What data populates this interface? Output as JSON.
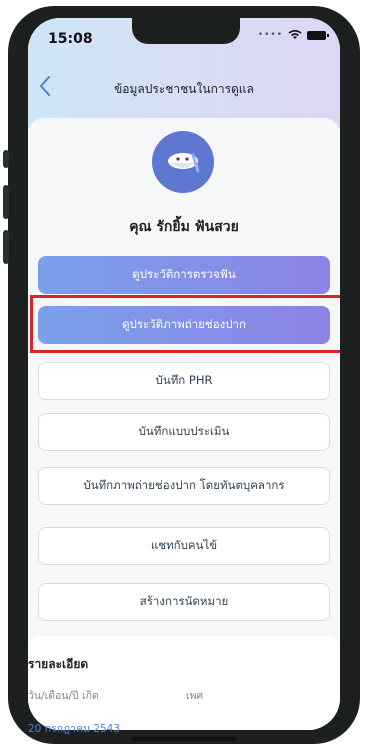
{
  "status_bar": {
    "time": "15:08"
  },
  "header": {
    "title": "ข้อมูลประชาชนในการดูแล",
    "back_icon": "chevron-left-icon"
  },
  "profile": {
    "name": "คุณ รักยิ้ม ฟันสวย",
    "avatar_icon": "tooth-icon"
  },
  "actions": {
    "view_dental_history": "ดูประวัติการตรวจฟัน",
    "view_oral_photos": "ดูประวัติภาพถ่ายช่องปาก",
    "record_phr": "บันทึก PHR",
    "record_assessment": "บันทึกแบบประเมิน",
    "record_photo_by_staff": "บันทึกภาพถ่ายช่องปาก โดยทันตบุคลากร",
    "chat_with_patient": "แชทกับคนไข้",
    "create_appointment": "สร้างการนัดหมาย"
  },
  "details": {
    "title": "รายละเอียด",
    "birthdate_label": "วัน/เดือน/ปี เกิด",
    "gender_label": "เพศ",
    "birthdate_value": "20 กรกฎาคม 2543"
  },
  "colors": {
    "accent": "#7aa0ea",
    "accent_end": "#8c83e6",
    "highlight": "#d92525",
    "avatar_bg": "#5f77d1"
  }
}
